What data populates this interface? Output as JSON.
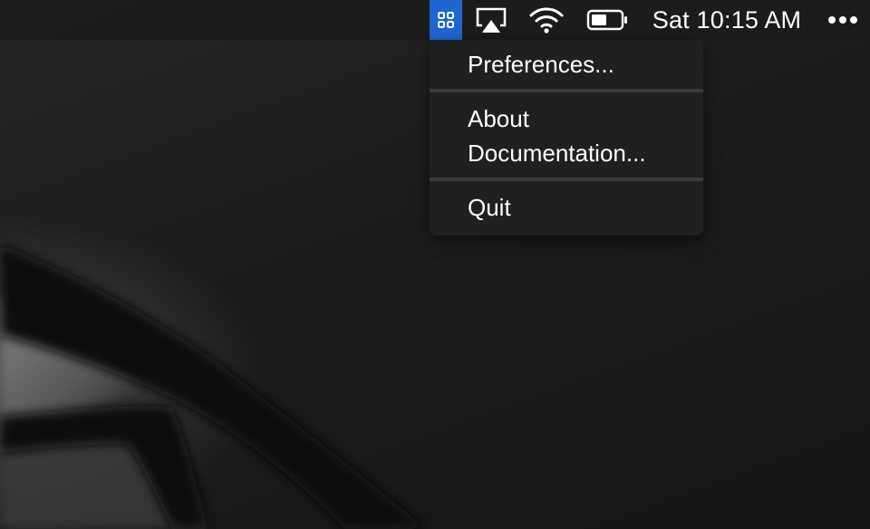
{
  "menubar": {
    "app_icon": "grid-app-icon",
    "airplay_icon": "airplay-icon",
    "wifi_icon": "wifi-icon",
    "battery_icon": "battery-icon",
    "clock": "Sat 10:15 AM",
    "more_icon": "more-icon",
    "accent_color": "#1f66d1"
  },
  "menu": {
    "items": [
      {
        "label": "Preferences..."
      },
      {
        "label": "About"
      },
      {
        "label": "Documentation..."
      },
      {
        "label": "Quit"
      }
    ]
  }
}
